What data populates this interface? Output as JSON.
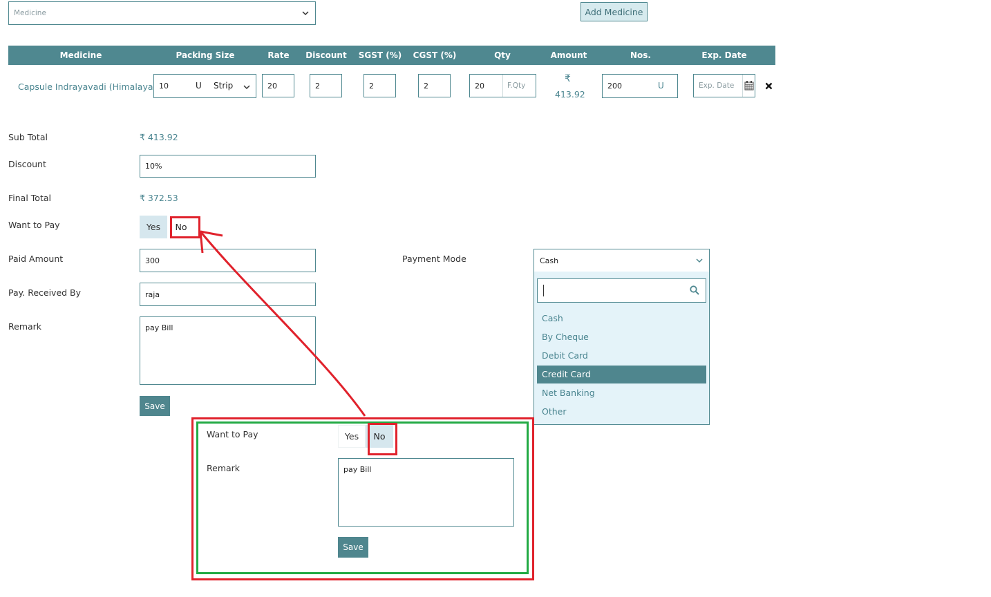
{
  "top": {
    "medicine_select_placeholder": "Medicine",
    "add_medicine_label": "Add Medicine"
  },
  "table": {
    "headers": [
      "Medicine",
      "Packing Size",
      "Rate",
      "Discount",
      "SGST (%)",
      "CGST (%)",
      "Qty",
      "Amount",
      "Nos.",
      "Exp. Date"
    ],
    "row": {
      "medicine": "Capsule Indrayavadi (Himalaya)",
      "packing_value": "10",
      "packing_unit": "U",
      "packing_type": "Strip",
      "rate": "20",
      "discount": "2",
      "sgst": "2",
      "cgst": "2",
      "qty": "20",
      "free_qty_placeholder": "F.Qty",
      "amount_symbol": "₹",
      "amount": "413.92",
      "nos": "200",
      "nos_unit": "U",
      "exp_date_placeholder": "Exp. Date"
    }
  },
  "summary": {
    "sub_total_label": "Sub Total",
    "sub_total_value": "₹ 413.92",
    "discount_label": "Discount",
    "discount_value": "10%",
    "final_total_label": "Final Total",
    "final_total_value": "₹ 372.53",
    "want_to_pay_label": "Want to Pay",
    "yes_label": "Yes",
    "no_label": "No",
    "paid_amount_label": "Paid Amount",
    "paid_amount_value": "300",
    "received_by_label": "Pay. Received By",
    "received_by_value": "raja",
    "remark_label": "Remark",
    "remark_value": "pay Bill",
    "save_label": "Save"
  },
  "payment": {
    "label": "Payment Mode",
    "selected": "Cash",
    "options": [
      "Cash",
      "By Cheque",
      "Debit Card",
      "Credit Card",
      "Net Banking",
      "Other"
    ],
    "highlighted": "Credit Card"
  },
  "inset": {
    "want_to_pay_label": "Want to Pay",
    "yes_label": "Yes",
    "no_label": "No",
    "remark_label": "Remark",
    "remark_value": "pay Bill",
    "save_label": "Save"
  },
  "colors": {
    "teal": "#4f8890",
    "annotation_red": "#e0222c",
    "annotation_green": "#22aa44",
    "dropdown_bg": "#e4f3f9"
  }
}
